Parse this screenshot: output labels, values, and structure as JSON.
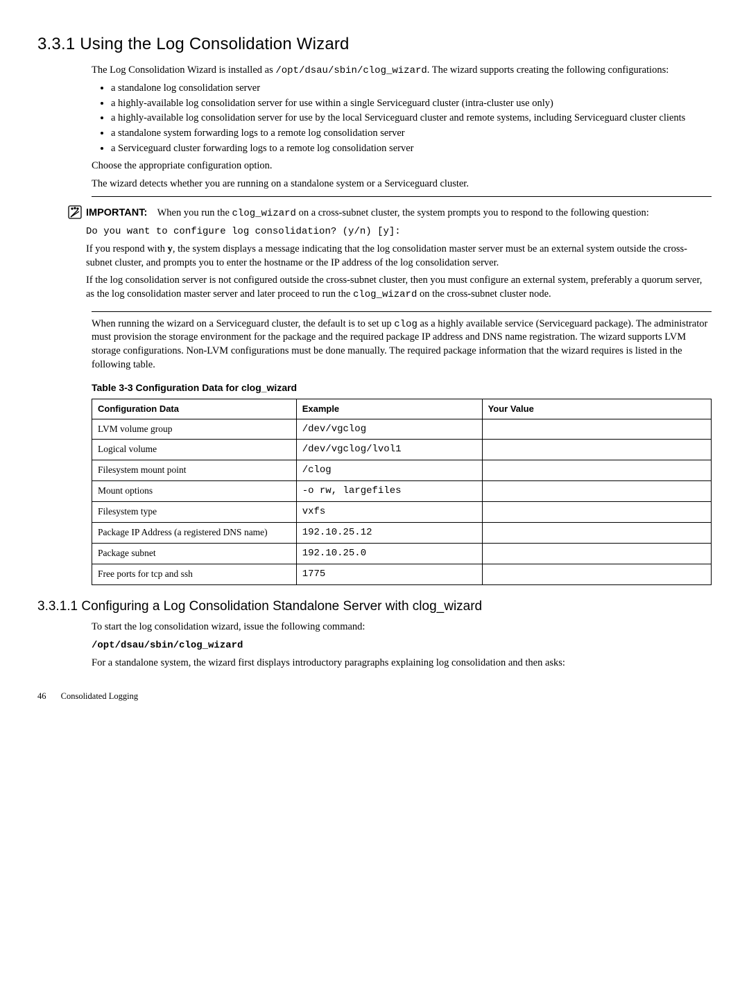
{
  "section": {
    "number": "3.3.1",
    "title": "Using the Log Consolidation Wizard"
  },
  "intro": {
    "p1_a": "The Log Consolidation Wizard is installed as ",
    "p1_code": "/opt/dsau/sbin/clog_wizard",
    "p1_b": ". The wizard supports creating the following configurations:",
    "bullets": [
      "a standalone log consolidation server",
      "a highly-available log consolidation server for use within a single Serviceguard cluster (intra-cluster use only)",
      "a highly-available log consolidation server for use by the local Serviceguard cluster and remote systems, including Serviceguard cluster clients",
      "a standalone system forwarding logs to a remote log consolidation server",
      "a Serviceguard cluster forwarding logs to a remote log consolidation server"
    ],
    "p2": "Choose the appropriate configuration option.",
    "p3": "The wizard detects whether you are running on a standalone system or a Serviceguard cluster."
  },
  "important": {
    "label": "IMPORTANT:",
    "p1_a": "When you run the ",
    "p1_code": "clog_wizard",
    "p1_b": " on a cross-subnet cluster, the system prompts you to respond to the following question:",
    "prompt": "Do you want to configure log consolidation? (y/n) [y]:",
    "p2_a": "If you respond with ",
    "p2_y": "y",
    "p2_b": ", the system displays a message indicating that the log consolidation master server must be an external system outside the cross-subnet cluster, and prompts you to enter the hostname or the IP address of the log consolidation server.",
    "p3_a": "If the log consolidation server is not configured outside the cross-subnet cluster, then you must configure an external system, preferably a quorum server, as the log consolidation master server and later proceed to run the ",
    "p3_code": "clog_wizard",
    "p3_b": " on the cross-subnet cluster node."
  },
  "after_important": {
    "p1_a": "When running the wizard on a Serviceguard cluster, the default is to set up ",
    "p1_code": "clog",
    "p1_b": " as a highly available service (Serviceguard package). The administrator must provision the storage environment for the package and the required package IP address and DNS name registration. The wizard supports LVM storage configurations. Non-LVM configurations must be done manually. The required package information that the wizard requires is listed in the following table."
  },
  "table": {
    "caption": "Table 3-3 Configuration Data for clog_wizard",
    "headers": [
      "Configuration Data",
      "Example",
      "Your Value"
    ],
    "rows": [
      {
        "c0": "LVM volume group",
        "c1": "/dev/vgclog",
        "c2": ""
      },
      {
        "c0": "Logical volume",
        "c1": "/dev/vgclog/lvol1",
        "c2": ""
      },
      {
        "c0": "Filesystem mount point",
        "c1": "/clog",
        "c2": ""
      },
      {
        "c0": "Mount options",
        "c1": "-o rw, largefiles",
        "c2": ""
      },
      {
        "c0": "Filesystem type",
        "c1": "vxfs",
        "c2": ""
      },
      {
        "c0": "Package IP Address (a registered DNS name)",
        "c1": "192.10.25.12",
        "c2": ""
      },
      {
        "c0": "Package subnet",
        "c1": "192.10.25.0",
        "c2": ""
      },
      {
        "c0": "Free ports for tcp and ssh",
        "c1": "1775",
        "c2": ""
      }
    ]
  },
  "subsection": {
    "number": "3.3.1.1",
    "title": "Configuring a Log Consolidation Standalone Server with clog_wizard",
    "p1": "To start the log consolidation wizard, issue the following command:",
    "cmd": "/opt/dsau/sbin/clog_wizard",
    "p2": "For a standalone system, the wizard first displays introductory paragraphs explaining log consolidation and then asks:"
  },
  "footer": {
    "page": "46",
    "chapter": "Consolidated Logging"
  }
}
